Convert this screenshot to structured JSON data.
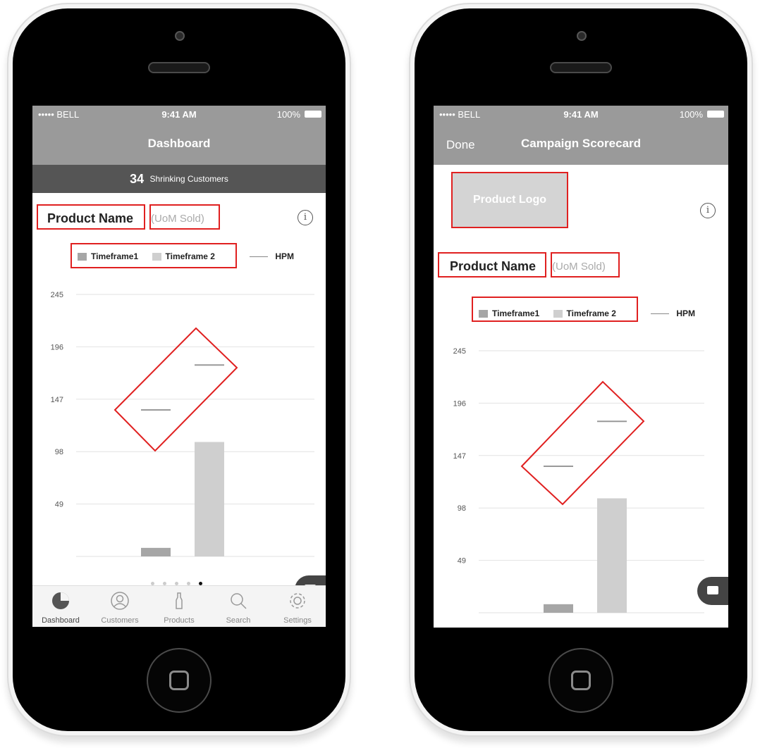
{
  "status_bar": {
    "carrier": "••••• BELL",
    "time": "9:41 AM",
    "battery": "100%"
  },
  "phone1": {
    "nav_title": "Dashboard",
    "banner_count": "34",
    "banner_text": "Shrinking Customers",
    "product_name": "Product Name",
    "uom": "(UoM Sold)",
    "info_icon": "i",
    "legend": {
      "t1": "Timeframe1",
      "t2": "Timeframe 2",
      "hpm": "HPM"
    },
    "pager": {
      "count": 5,
      "active_index": 4
    },
    "tabs": [
      {
        "label": "Dashboard",
        "icon": "pie-chart-icon"
      },
      {
        "label": "Customers",
        "icon": "user-icon"
      },
      {
        "label": "Products",
        "icon": "bottle-icon"
      },
      {
        "label": "Search",
        "icon": "search-icon"
      },
      {
        "label": "Settings",
        "icon": "gear-icon"
      }
    ]
  },
  "phone2": {
    "done_label": "Done",
    "nav_title": "Campaign Scorecard",
    "logo_label": "Product Logo",
    "product_name": "Product Name",
    "uom": "(UoM Sold)",
    "info_icon": "i",
    "legend": {
      "t1": "Timeframe1",
      "t2": "Timeframe 2",
      "hpm": "HPM"
    }
  },
  "colors": {
    "timeframe1": "#a6a6a6",
    "timeframe2": "#cfcfcf",
    "hpm": "#999999",
    "annotation": "#e02020"
  },
  "chart_data": [
    {
      "type": "bar",
      "categories": [
        "Timeframe1",
        "Timeframe 2"
      ],
      "series": [
        {
          "name": "Timeframe1/Timeframe 2",
          "values": [
            8,
            107
          ]
        }
      ],
      "hpm": [
        137,
        179
      ],
      "ytick_labels": [
        "245",
        "196",
        "147",
        "98",
        "49"
      ],
      "ylim": [
        0,
        245
      ],
      "grid": true
    },
    {
      "type": "bar",
      "categories": [
        "Timeframe1",
        "Timeframe 2"
      ],
      "series": [
        {
          "name": "Timeframe1/Timeframe 2",
          "values": [
            8,
            107
          ]
        }
      ],
      "hpm": [
        137,
        179
      ],
      "ytick_labels": [
        "245",
        "196",
        "147",
        "98",
        "49"
      ],
      "ylim": [
        0,
        245
      ],
      "grid": true
    }
  ]
}
